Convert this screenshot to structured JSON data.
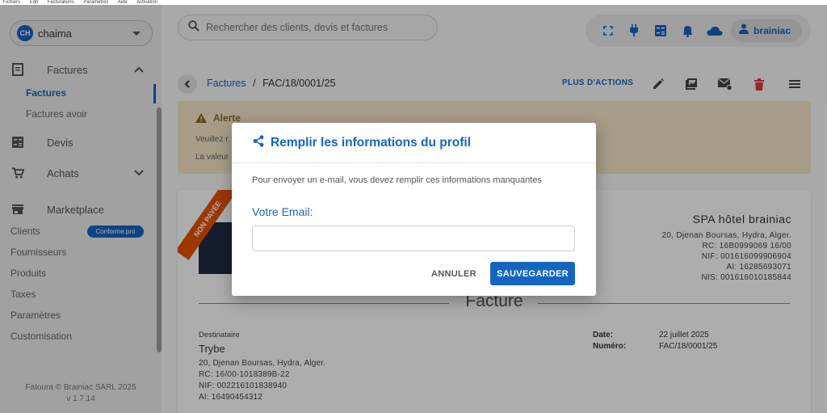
{
  "os_menu": [
    "Fichiers",
    "Edit",
    "Facturations",
    "Paramètres",
    "Aide",
    "Activation"
  ],
  "sidebar": {
    "user": {
      "initials": "CH",
      "name": "chaima"
    },
    "sections": [
      {
        "label": "Factures",
        "icon": "invoice-icon",
        "chevron": "up"
      },
      {
        "label": "Devis",
        "icon": "calculator-icon"
      },
      {
        "label": "Achats",
        "icon": "cart-icon",
        "chevron": "down"
      },
      {
        "label": "Marketplace",
        "icon": "store-icon"
      }
    ],
    "factures_sub": [
      "Factures",
      "Factures avoir"
    ],
    "items": [
      "Clients",
      "Fournisseurs",
      "Produits",
      "Taxes",
      "Paramètres",
      "Customisation"
    ],
    "clients_badge": "Conforme.pro",
    "footer": {
      "copyright": "Fatoura © Brainiac SARL 2025",
      "version": "v 1.7.14"
    }
  },
  "header": {
    "search_placeholder": "Rechercher des clients, devis et factures",
    "account_name": "brainiac"
  },
  "toolbar": {
    "crumb_link": "Factures",
    "crumb_sep": "/",
    "crumb_current": "FAC/18/0001/25",
    "more_actions": "PLUS D'ACTIONS"
  },
  "alert": {
    "title": "Alerte",
    "line1": "Veuillez r",
    "line2": "La valeur"
  },
  "invoice": {
    "ribbon": "NON PAYÉE",
    "company_name": "SPA hôtel brainiac",
    "company_lines": [
      "20, Djenan Boursas, Hydra, Alger.",
      "RC: 16B0999069 16/00",
      "NIF: 001616099906904",
      "AI: 16285693071",
      "NIS: 001616010185844"
    ],
    "title": "Facture",
    "dest_label": "Destinataire",
    "dest_name": "Trybe",
    "dest_lines": [
      "20, Djenan Boursas, Hydra, Alger.",
      "RC: 16/00-1018389B-22",
      "NIF: 002216101838940",
      "AI: 16490454312"
    ],
    "date_label": "Date:",
    "date_value": "22 juillet 2025",
    "number_label": "Numéro:",
    "number_value": "FAC/18/0001/25"
  },
  "modal": {
    "title": "Remplir les informations du profil",
    "description": "Pour envoyer un e-mail, vous devez remplir ces informations manquantes",
    "email_label": "Votre Email:",
    "email_value": "",
    "cancel_label": "ANNULER",
    "save_label": "SAUVEGARDER"
  },
  "colors": {
    "primary": "#1565c0",
    "alert_bg": "#f5e6c8",
    "ribbon": "#e65100",
    "delete": "#e53935"
  }
}
